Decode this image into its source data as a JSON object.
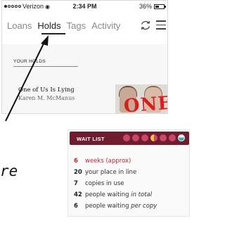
{
  "status_bar": {
    "carrier": "Verizon",
    "time": "2:34 PM",
    "battery": "36%"
  },
  "tabs": [
    {
      "label": "Loans",
      "active": false
    },
    {
      "label": "Holds",
      "active": true
    },
    {
      "label": "Tags",
      "active": false
    },
    {
      "label": "Activity",
      "active": false
    }
  ],
  "icons": {
    "refresh": "refresh-icon",
    "menu": "menu-icon"
  },
  "holds": {
    "section_label": "YOUR HOLDS",
    "book": {
      "title": "One of Us Is Lying",
      "author": "Karen M. McManus",
      "cover_title": "ONE"
    }
  },
  "side_word": "re",
  "wait_list": {
    "title": "WAIT LIST",
    "accent_color": "#6f1c2e",
    "rows": [
      {
        "number": "6",
        "text": "weeks (approx)",
        "accent": true
      },
      {
        "number": "20",
        "text": "your place in line",
        "accent": false
      },
      {
        "number": "7",
        "text": "copies in use",
        "accent": false
      },
      {
        "number": "42",
        "text": "people waiting",
        "emphasis": "in total",
        "accent": false
      },
      {
        "number": "6",
        "text": "people waiting",
        "emphasis": "per copy",
        "accent": false
      }
    ]
  }
}
